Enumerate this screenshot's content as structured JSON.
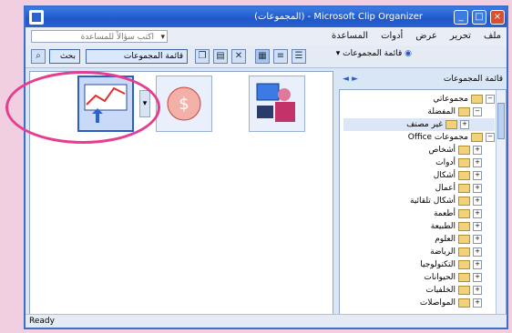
{
  "window": {
    "title": "Microsoft Clip Organizer - (المجموعات)",
    "controls": {
      "minimize": "_",
      "maximize": "□",
      "close": "×"
    }
  },
  "menu": {
    "items": [
      "ملف",
      "تحرير",
      "عرض",
      "أدوات",
      "المساعدة"
    ],
    "address_placeholder": "اكتب سؤالاً للمساعدة"
  },
  "toolbar": {
    "search_label": "بحث",
    "collections_label": "قائمة المجموعات",
    "icons": [
      "copy-icon",
      "paste-icon",
      "delete-icon",
      "view-thumbnails-icon",
      "view-list-icon",
      "view-details-icon"
    ]
  },
  "pane": {
    "title": "قائمة المجموعات",
    "nav_back": "◄",
    "nav_forward": "►"
  },
  "tree": [
    {
      "label": "مجموعاتي",
      "level": 0,
      "expanded": true
    },
    {
      "label": "المفضلة",
      "level": 1,
      "expanded": true
    },
    {
      "label": "غير مصنف",
      "level": 2
    },
    {
      "label": "مجموعات Office",
      "level": 0,
      "expanded": true
    },
    {
      "label": "أشخاص",
      "level": 1
    },
    {
      "label": "أدوات",
      "level": 1
    },
    {
      "label": "أشكال",
      "level": 1
    },
    {
      "label": "أعمال",
      "level": 1
    },
    {
      "label": "أشكال تلقائية",
      "level": 1
    },
    {
      "label": "أطعمة",
      "level": 1
    },
    {
      "label": "الطبيعة",
      "level": 1
    },
    {
      "label": "العلوم",
      "level": 1
    },
    {
      "label": "الرياضة",
      "level": 1
    },
    {
      "label": "التكنولوجيا",
      "level": 1
    },
    {
      "label": "الحيوانات",
      "level": 1
    },
    {
      "label": "الخلفيات",
      "level": 1
    },
    {
      "label": "المواصلات",
      "level": 1
    }
  ],
  "status": {
    "left": "Ready"
  },
  "colors": {
    "accent": "#2c5cc5",
    "annotation": "#e53d8f"
  }
}
